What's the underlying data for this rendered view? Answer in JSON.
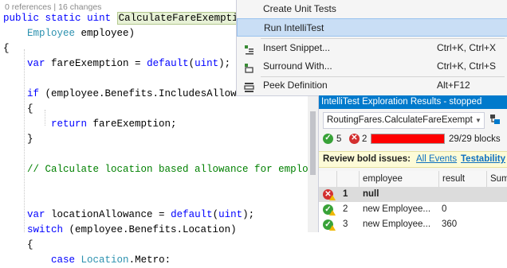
{
  "editor": {
    "codelens": {
      "references": "0 references",
      "changes": "16 changes"
    },
    "lines": [
      {
        "parts": [
          {
            "t": "public",
            "c": "kw"
          },
          {
            "t": " "
          },
          {
            "t": "static",
            "c": "kw"
          },
          {
            "t": " "
          },
          {
            "t": "uint",
            "c": "kw"
          },
          {
            "t": " "
          },
          {
            "t": "CalculateFareExemption",
            "c": "hl"
          }
        ]
      },
      {
        "parts": [
          {
            "t": "    "
          },
          {
            "t": "Employee",
            "c": "ty"
          },
          {
            "t": " employee)"
          }
        ]
      },
      {
        "parts": [
          {
            "t": "{"
          }
        ]
      },
      {
        "parts": [
          {
            "t": "    "
          },
          {
            "t": "var",
            "c": "kw"
          },
          {
            "t": " fareExemption = "
          },
          {
            "t": "default",
            "c": "kw"
          },
          {
            "t": "("
          },
          {
            "t": "uint",
            "c": "kw"
          },
          {
            "t": ");"
          }
        ]
      },
      {
        "parts": [
          {
            "t": ""
          }
        ]
      },
      {
        "parts": [
          {
            "t": "    "
          },
          {
            "t": "if",
            "c": "kw"
          },
          {
            "t": " (employee.Benefits.IncludesAllowance"
          }
        ]
      },
      {
        "parts": [
          {
            "t": "    {"
          }
        ]
      },
      {
        "parts": [
          {
            "t": "        "
          },
          {
            "t": "return",
            "c": "kw"
          },
          {
            "t": " fareExemption;"
          }
        ]
      },
      {
        "parts": [
          {
            "t": "    }"
          }
        ]
      },
      {
        "parts": [
          {
            "t": ""
          }
        ]
      },
      {
        "parts": [
          {
            "t": "    "
          },
          {
            "t": "// Calculate location based allowance for employee",
            "c": "cm"
          }
        ]
      },
      {
        "parts": [
          {
            "t": ""
          }
        ]
      },
      {
        "parts": [
          {
            "t": ""
          }
        ]
      },
      {
        "parts": [
          {
            "t": "    "
          },
          {
            "t": "var",
            "c": "kw"
          },
          {
            "t": " locationAllowance = "
          },
          {
            "t": "default",
            "c": "kw"
          },
          {
            "t": "("
          },
          {
            "t": "uint",
            "c": "kw"
          },
          {
            "t": ");"
          }
        ]
      },
      {
        "parts": [
          {
            "t": "    "
          },
          {
            "t": "switch",
            "c": "kw"
          },
          {
            "t": " (employee.Benefits.Location)"
          }
        ]
      },
      {
        "parts": [
          {
            "t": "    {"
          }
        ]
      },
      {
        "parts": [
          {
            "t": "        "
          },
          {
            "t": "case",
            "c": "kw"
          },
          {
            "t": " "
          },
          {
            "t": "Location",
            "c": "ty"
          },
          {
            "t": ".Metro:"
          }
        ]
      }
    ]
  },
  "context_menu": {
    "items": [
      {
        "label": "Create Unit Tests",
        "shortcut": "",
        "icon": "",
        "active": false
      },
      {
        "label": "Run IntelliTest",
        "shortcut": "",
        "icon": "",
        "active": true
      },
      {
        "label": "Insert Snippet...",
        "shortcut": "Ctrl+K, Ctrl+X",
        "icon": "snippet-icon",
        "active": false
      },
      {
        "label": "Surround With...",
        "shortcut": "Ctrl+K, Ctrl+S",
        "icon": "surround-icon",
        "active": false
      },
      {
        "label": "Peek Definition",
        "shortcut": "Alt+F12",
        "icon": "peek-icon",
        "active": false
      }
    ]
  },
  "intellitest": {
    "title": "IntelliTest Exploration Results - stopped",
    "selected_method": "RoutingFares.CalculateFareExemption",
    "stats": {
      "passed": "5",
      "failed": "2",
      "blocks": "29/29 blocks",
      "progress": 1.0
    },
    "review": {
      "title": "Review bold issues:",
      "link_all": "All Events",
      "link_testability": "Testability"
    },
    "columns": [
      "employee",
      "result",
      "Sum"
    ],
    "rows": [
      {
        "num": "1",
        "employee": "null",
        "result": "",
        "status": "fail",
        "selected": true
      },
      {
        "num": "2",
        "employee": "new Employee...",
        "result": "0",
        "status": "pass",
        "selected": false
      },
      {
        "num": "3",
        "employee": "new Employee...",
        "result": "360",
        "status": "pass",
        "selected": false
      }
    ]
  },
  "colors": {
    "accent": "#007acc",
    "pass": "#38a238",
    "fail": "#d32f2f",
    "progress": "#ff0000"
  }
}
